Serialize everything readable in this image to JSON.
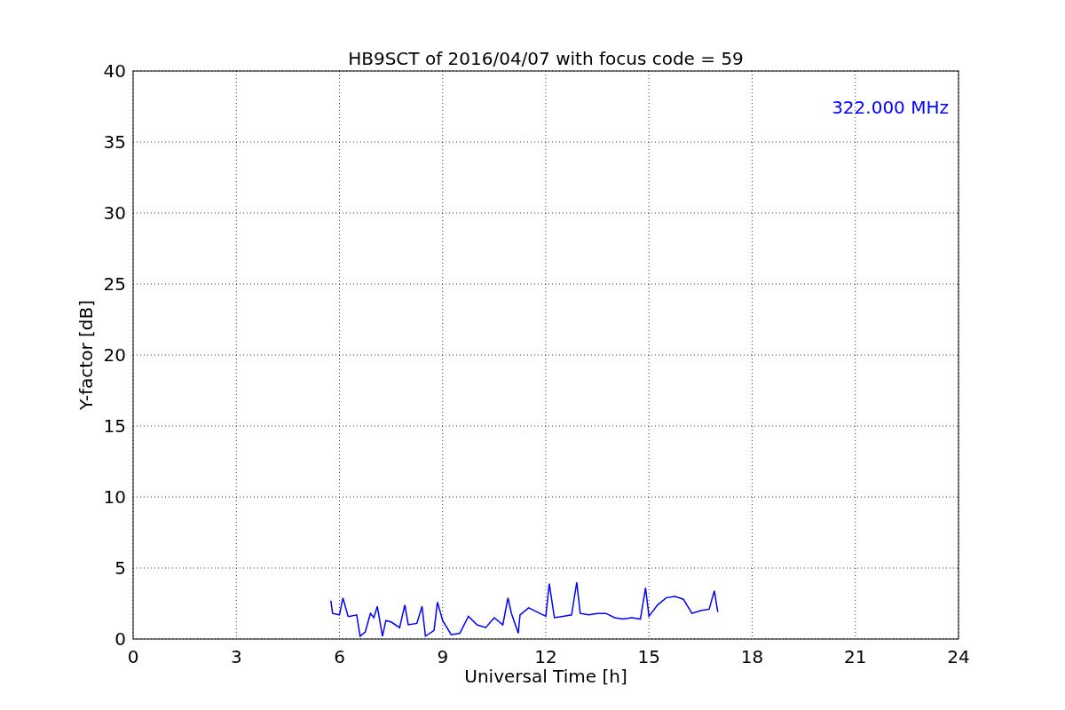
{
  "chart_data": {
    "type": "line",
    "title": "HB9SCT of 2016/04/07 with focus code = 59",
    "xlabel": "Universal Time [h]",
    "ylabel": "Y-factor [dB]",
    "x": [
      5.75,
      5.8,
      6.0,
      6.1,
      6.25,
      6.3,
      6.5,
      6.6,
      6.75,
      6.9,
      7.0,
      7.1,
      7.25,
      7.35,
      7.5,
      7.75,
      7.9,
      8.0,
      8.25,
      8.4,
      8.5,
      8.75,
      8.85,
      9.0,
      9.25,
      9.5,
      9.75,
      10.0,
      10.25,
      10.5,
      10.75,
      10.9,
      11.0,
      11.2,
      11.25,
      11.5,
      11.75,
      12.0,
      12.1,
      12.25,
      12.5,
      12.75,
      12.9,
      13.0,
      13.25,
      13.5,
      13.75,
      14.0,
      14.25,
      14.5,
      14.75,
      14.9,
      15.0,
      15.25,
      15.5,
      15.75,
      16.0,
      16.25,
      16.5,
      16.75,
      16.9,
      17.0
    ],
    "series": [
      {
        "color": "#0000ff",
        "values": [
          2.7,
          1.8,
          1.7,
          2.9,
          1.6,
          1.6,
          1.7,
          0.2,
          0.5,
          1.8,
          1.5,
          2.3,
          0.2,
          1.3,
          1.2,
          0.8,
          2.4,
          1.0,
          1.1,
          2.3,
          0.2,
          0.6,
          2.6,
          1.3,
          0.3,
          0.4,
          1.6,
          1.0,
          0.8,
          1.5,
          1.0,
          2.9,
          1.8,
          0.4,
          1.7,
          2.2,
          1.9,
          1.6,
          3.9,
          1.5,
          1.6,
          1.7,
          4.0,
          1.8,
          1.7,
          1.8,
          1.8,
          1.5,
          1.4,
          1.5,
          1.4,
          3.6,
          1.6,
          2.4,
          2.9,
          3.0,
          2.8,
          1.8,
          2.0,
          2.1,
          3.4,
          1.9
        ]
      }
    ],
    "xlim": [
      0,
      24
    ],
    "ylim": [
      0,
      40
    ],
    "xticks": [
      0,
      3,
      6,
      9,
      12,
      15,
      18,
      21,
      24
    ],
    "yticks": [
      0,
      5,
      10,
      15,
      20,
      25,
      30,
      35,
      40
    ],
    "grid": true,
    "annotations": [
      "322.000 MHz"
    ]
  }
}
